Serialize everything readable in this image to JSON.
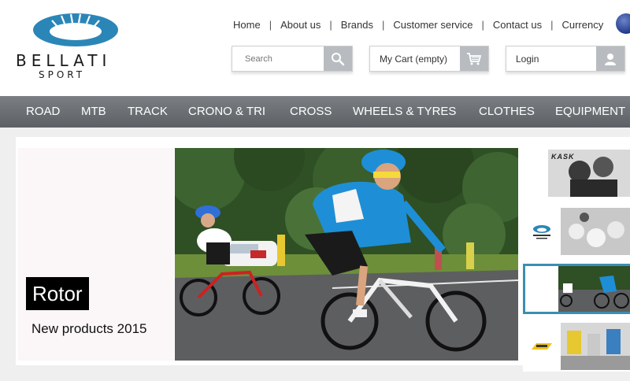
{
  "header": {
    "logo": {
      "brand": "BELLATI",
      "sub": "SPORT",
      "emblem_color": "#2b86b8"
    },
    "top_nav": [
      "Home",
      "About us",
      "Brands",
      "Customer service",
      "Contact us",
      "Currency"
    ],
    "search": {
      "placeholder": "Search",
      "icon": "search-icon"
    },
    "cart": {
      "label": "My Cart (empty)",
      "icon": "cart-icon"
    },
    "login": {
      "label": "Login",
      "icon": "user-icon"
    }
  },
  "navbar": {
    "items": [
      "ROAD",
      "MTB",
      "TRACK",
      "CRONO & TRI",
      "CROSS",
      "WHEELS & TYRES",
      "CLOTHES",
      "EQUIPMENT"
    ],
    "color": "#6e7276"
  },
  "promo": {
    "title": "Rotor",
    "subtitle": "New products 2015"
  },
  "thumbnails": [
    {
      "brand": "KASK"
    },
    {
      "brand": ""
    },
    {
      "brand": ""
    },
    {
      "brand": ""
    }
  ],
  "colors": {
    "accent": "#3b8fb0",
    "jersey": "#1e8fd6"
  }
}
